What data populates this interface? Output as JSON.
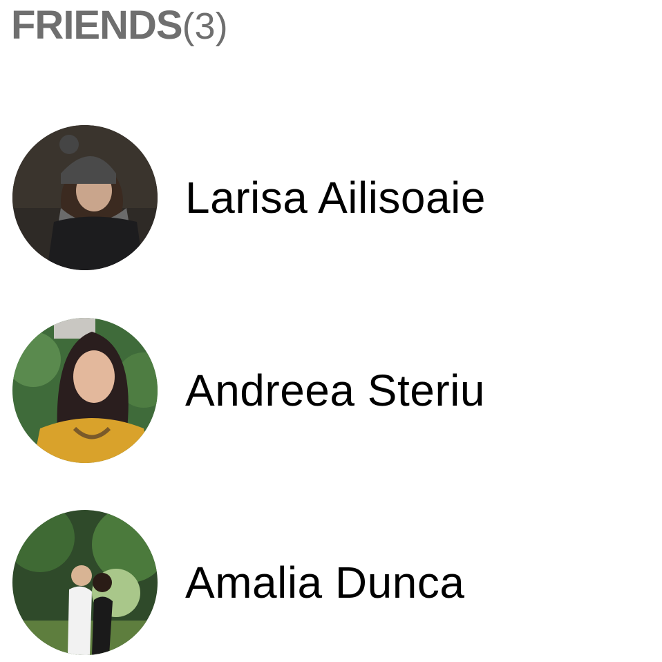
{
  "header": {
    "title": "FRIENDS",
    "count": "(3)"
  },
  "friends": [
    {
      "name": "Larisa Ailisoaie",
      "avatar": "avatar-photo"
    },
    {
      "name": "Andreea Steriu",
      "avatar": "avatar-photo"
    },
    {
      "name": "Amalia Dunca",
      "avatar": "avatar-photo"
    }
  ],
  "colors": {
    "header_text": "#6f6f6f",
    "name_text": "#000000",
    "background": "#ffffff"
  }
}
